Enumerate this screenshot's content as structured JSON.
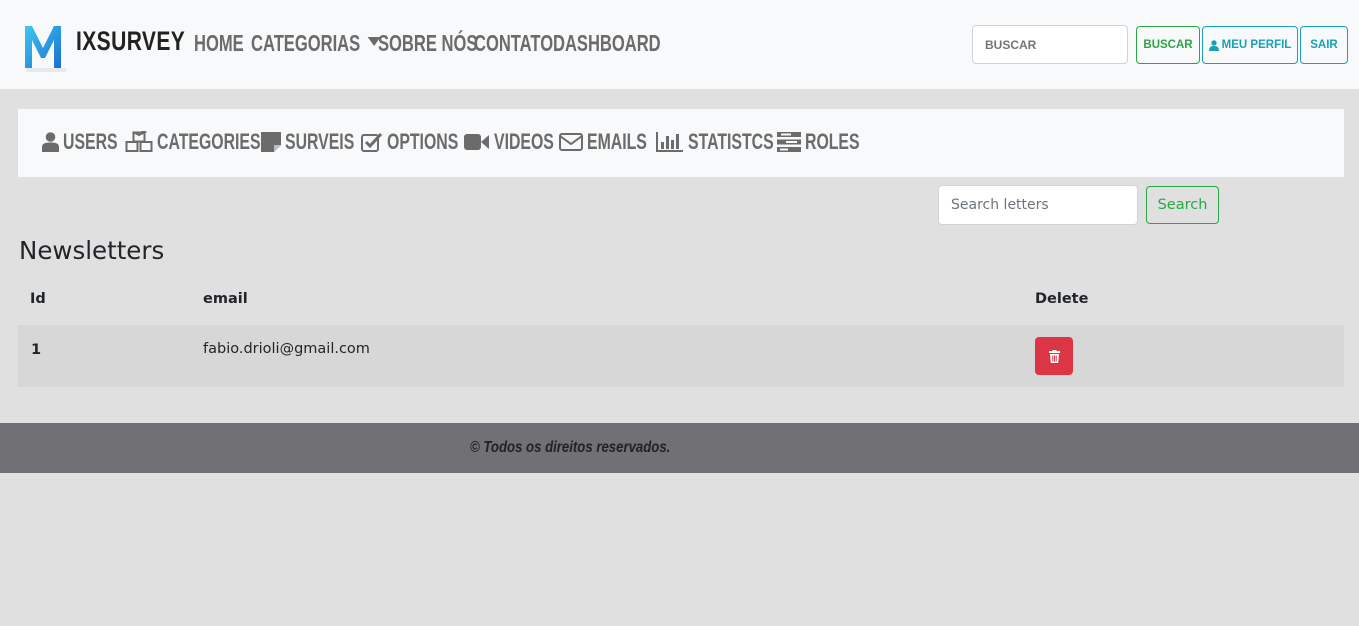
{
  "navbar": {
    "brand": "IXSURVEY",
    "links": [
      "HOME",
      "CATEGORIAS",
      "SOBRE NÓS",
      "CONTATO",
      "DASHBOARD"
    ],
    "search_placeholder": "BUSCAR",
    "search_button": "BUSCAR",
    "profile_button": "MEU PERFIL",
    "logout_button": "SAIR"
  },
  "admin_nav": {
    "items": [
      "USERS",
      "CATEGORIES",
      "SURVEIS",
      "OPTIONS",
      "VIDEOS",
      "EMAILS",
      "STATISTCS",
      "ROLES"
    ]
  },
  "search": {
    "placeholder": "Search letters",
    "button": "Search"
  },
  "page_title": "Newsletters",
  "table": {
    "headers": [
      "Id",
      "email",
      "Delete"
    ],
    "rows": [
      {
        "id": "1",
        "email": "fabio.drioli@gmail.com"
      }
    ]
  },
  "footer": {
    "text": "© Todos os direitos reservados."
  },
  "colors": {
    "accent_green": "#28a745",
    "accent_teal": "#17a2b8",
    "danger": "#dc3545",
    "footer_bg": "#707075"
  }
}
